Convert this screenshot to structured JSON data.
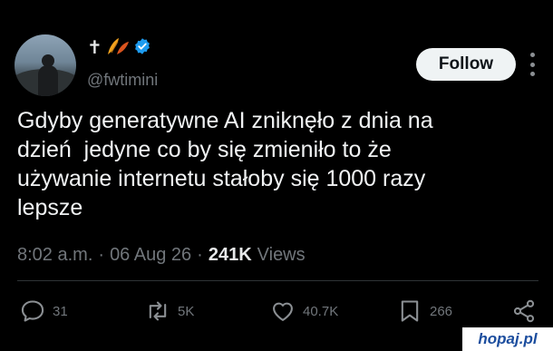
{
  "author": {
    "name_symbol": "✝",
    "handle": "@fwtimini",
    "verified_color": "#1d9bf0"
  },
  "follow_label": "Follow",
  "tweet_text": "Gdyby generatywne AI zniknęło z dnia na\ndzień  jedyne co by się zmieniło to że\nużywanie internetu stałoby się 1000 razy\nlepsze",
  "meta": {
    "time": "8:02 a.m.",
    "date": "06 Aug 26",
    "views_count": "241K",
    "views_label": "Views"
  },
  "actions": {
    "replies": "31",
    "reposts": "5K",
    "likes": "40.7K",
    "bookmarks": "266"
  },
  "watermark": "hopaj.pl",
  "icons": [
    "cross-icon",
    "leaf-icon",
    "verified-badge-icon",
    "more-icon",
    "reply-icon",
    "repost-icon",
    "like-icon",
    "bookmark-icon",
    "share-icon"
  ],
  "colors": {
    "background": "#000000",
    "text": "#e7e9ea",
    "muted": "#71767b",
    "accent": "#1d9bf0",
    "button": "#eff3f4"
  }
}
